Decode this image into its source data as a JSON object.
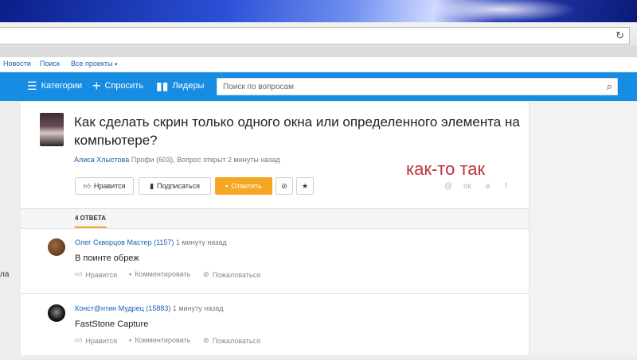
{
  "browser": {
    "reload_icon": "reload-icon"
  },
  "topnav": {
    "news": "Новости",
    "search": "Поиск",
    "all_projects": "Все проекты"
  },
  "navbar": {
    "categories": "Категории",
    "ask": "Спросить",
    "leaders": "Лидеры",
    "search_placeholder": "Поиск по вопросам"
  },
  "left_fragment": {
    "text": "ла"
  },
  "question": {
    "title": "Как сделать скрин только одного окна или определенного элемента на компьютере?",
    "author": "Алиса Хлыстова",
    "author_meta": "Профи (603), Вопрос открыт 2 минуты назад",
    "buttons": {
      "like": "Нравится",
      "subscribe": "Подписаться",
      "answer": "Ответить"
    },
    "annotation": "как-то так",
    "share_icons": [
      "@",
      "ок",
      "в",
      "f"
    ]
  },
  "answers": {
    "tab_label": "4 ОТВЕТА",
    "items": [
      {
        "name": "Олег Скворцов",
        "rank": "Мастер (1157)",
        "time": "1 минуту назад",
        "text": "В поинте обреж",
        "like": "Нравится",
        "comment": "Комментировать",
        "report": "Пожаловаться"
      },
      {
        "name": "Конст@нтин",
        "rank": "Мудрец (15883)",
        "time": "1 минуту назад",
        "text": "FastStone Capture",
        "like": "Нравится",
        "comment": "Комментировать",
        "report": "Пожаловаться"
      }
    ]
  },
  "colors": {
    "accent": "#168de2",
    "answer_button": "#f5a623",
    "link": "#1a5fb4",
    "annotation": "#c0303b"
  }
}
